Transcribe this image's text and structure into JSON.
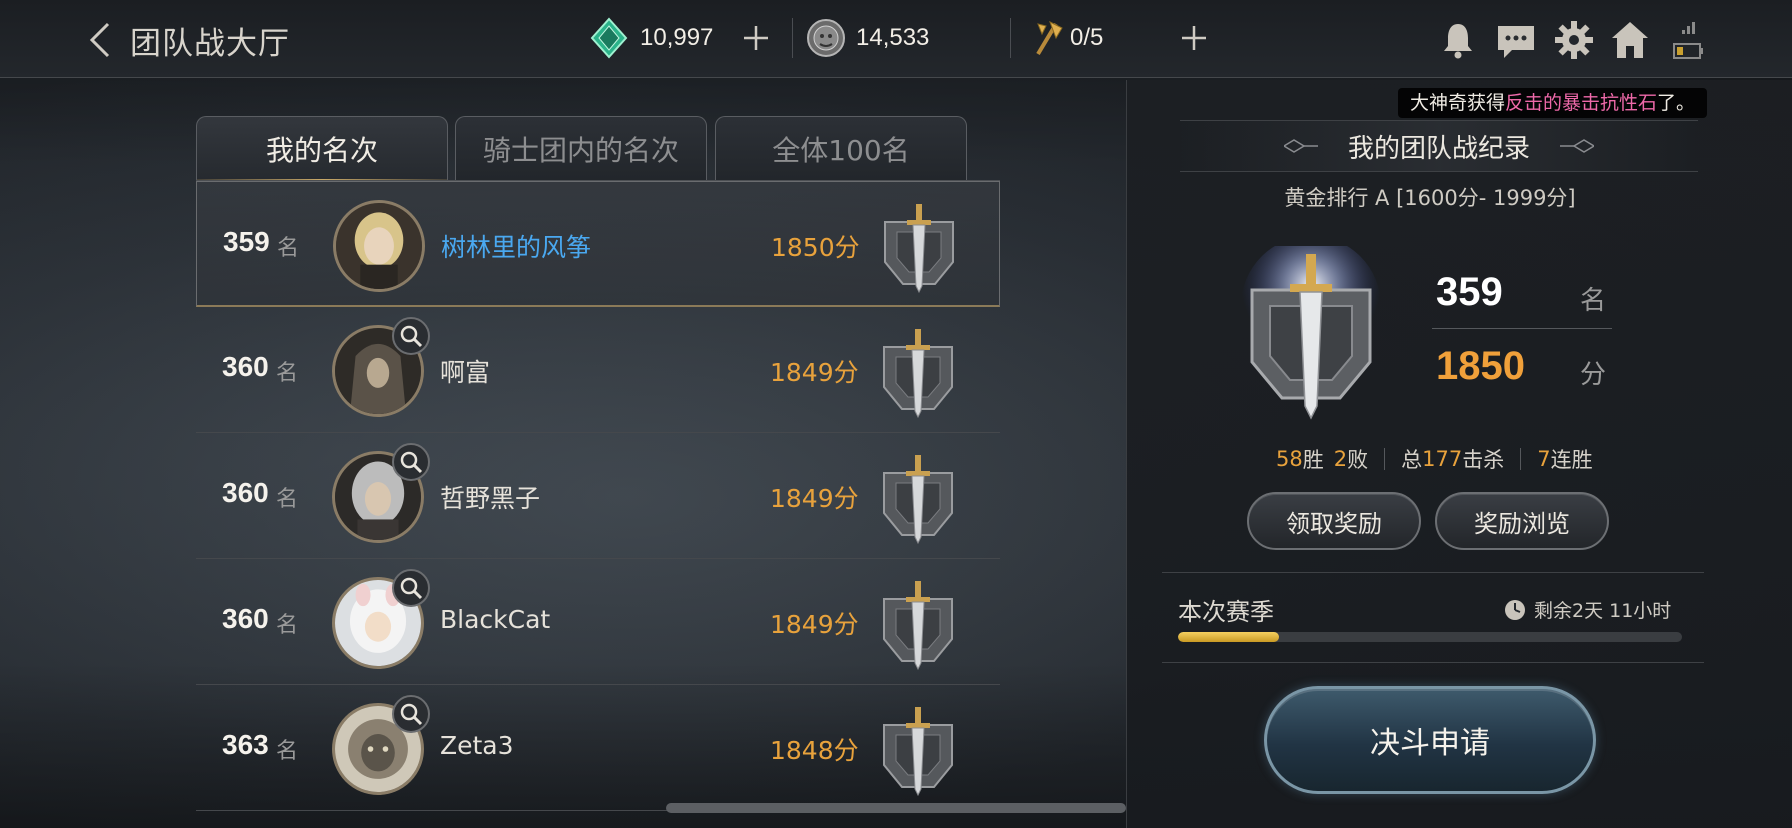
{
  "header": {
    "title": "团队战大厅",
    "gems": "10,997",
    "silver": "14,533",
    "tickets": "0/5"
  },
  "tabs": [
    {
      "label": "我的名次",
      "active": true
    },
    {
      "label": "骑士团内的名次",
      "active": false
    },
    {
      "label": "全体100名",
      "active": false
    }
  ],
  "ranking": {
    "rank_unit": "名",
    "rows": [
      {
        "rank": "359",
        "name": "树林里的风筝",
        "score": "1850分",
        "self": true
      },
      {
        "rank": "360",
        "name": "啊富",
        "score": "1849分",
        "self": false
      },
      {
        "rank": "360",
        "name": "哲野黑子",
        "score": "1849分",
        "self": false
      },
      {
        "rank": "360",
        "name": "BlackCat",
        "score": "1849分",
        "self": false
      },
      {
        "rank": "363",
        "name": "Zeta3",
        "score": "1848分",
        "self": false
      }
    ]
  },
  "toast": {
    "prefix": "大神奇获得",
    "item": "反击的暴击抗性石",
    "suffix": "了。"
  },
  "record": {
    "title": "我的团队战纪录",
    "tier": "黄金排行 A [1600分- 1999分]",
    "rank": "359",
    "rank_unit": "名",
    "score": "1850",
    "score_unit": "分",
    "wins": "58",
    "wins_label": "胜",
    "losses": "2",
    "losses_label": "败",
    "kills_prefix": "总",
    "kills": "177",
    "kills_label": "击杀",
    "streak": "7",
    "streak_label": "连胜",
    "claim_button": "领取奖励",
    "browse_button": "奖励浏览"
  },
  "season": {
    "label": "本次赛季",
    "remaining": "剩余2天 11小时",
    "progress": 0.2
  },
  "duel_button": "决斗申请",
  "colors": {
    "score_orange": "#e8a23c",
    "self_name_blue": "#4aa8f0",
    "toast_highlight": "#ee69a9"
  }
}
